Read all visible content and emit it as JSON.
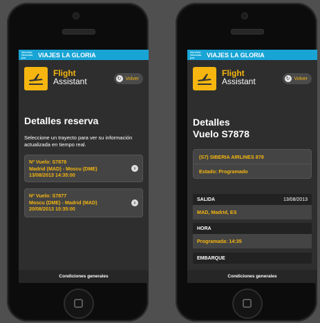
{
  "header": {
    "tiny_text": "Servicio Ofrecido por",
    "brand": "VIAJES LA GLORIA"
  },
  "app": {
    "title_line1": "Flight",
    "title_line2": "Assistant",
    "back_label": "Volver",
    "back_icon": "refresh-icon",
    "plane_icon": "airplane-takeoff-icon"
  },
  "screen1": {
    "title": "Detalles reserva",
    "description": "Seleccione un trayecto para ver su información actualizada en tiempo real.",
    "flights": [
      {
        "number": "Nº Vuelo: S7878",
        "route": "Madrid (MAD) - Moscu (DME)",
        "datetime": "13/08/2013 14:35:00"
      },
      {
        "number": "Nº Vuelo: S7877",
        "route": "Moscu (DME) - Madrid (MAD)",
        "datetime": "20/08/2013 10:35:00"
      }
    ]
  },
  "screen2": {
    "title_line1": "Detalles",
    "title_line2": "Vuelo S7878",
    "airline": "(S7) SIBERIA AIRLINES 878",
    "status": "Estado: Programado",
    "salida_label": "SALIDA",
    "salida_date": "13/08/2013",
    "salida_place": "MAD, Madrid, ES",
    "hora_label": "HORA",
    "hora_value": "Programada: 14:35",
    "embarque_label": "EMBARQUE"
  },
  "footer": {
    "label": "Condiciones generales"
  },
  "colors": {
    "accent": "#f6b60f",
    "topbar": "#19a4d6",
    "screen_bg": "#2e2e2e"
  }
}
